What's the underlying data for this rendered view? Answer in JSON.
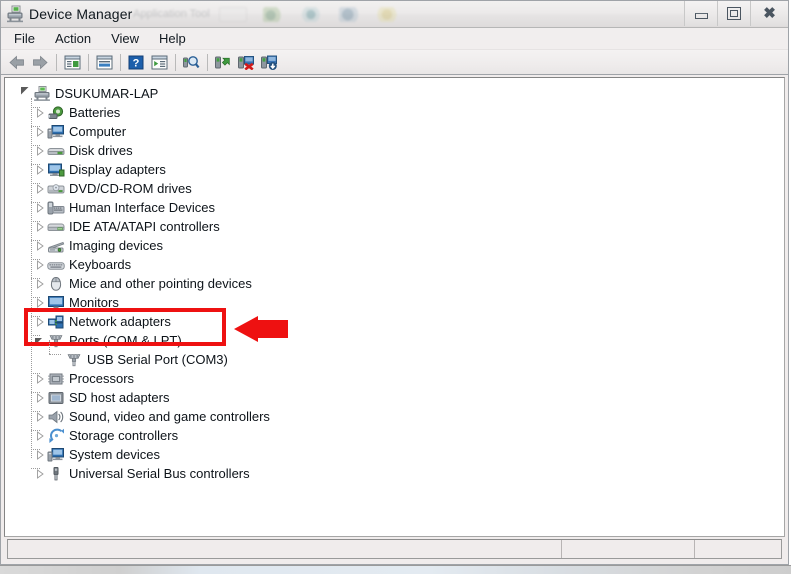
{
  "window": {
    "title": "Device Manager",
    "title_icon": "device-manager-icon",
    "ghost_text": "Application Tool",
    "controls": {
      "minimize": "Minimize",
      "maximize": "Maximize",
      "close": "Close"
    }
  },
  "menubar": {
    "items": [
      {
        "label": "File"
      },
      {
        "label": "Action"
      },
      {
        "label": "View"
      },
      {
        "label": "Help"
      }
    ]
  },
  "toolbar": {
    "buttons": [
      {
        "name": "back-button",
        "icon": "arrow-left-icon",
        "label": "Back"
      },
      {
        "name": "forward-button",
        "icon": "arrow-right-icon",
        "label": "Forward"
      },
      {
        "name": "show-hide-console-tree-button",
        "icon": "console-tree-icon",
        "label": "Show/Hide Console Tree"
      },
      {
        "name": "properties-button",
        "icon": "properties-icon",
        "label": "Properties"
      },
      {
        "name": "help-button",
        "icon": "help-question-icon",
        "label": "Help"
      },
      {
        "name": "show-hide-action-pane-button",
        "icon": "action-pane-icon",
        "label": "Show/Hide Action Pane"
      },
      {
        "name": "scan-for-hardware-changes-button",
        "icon": "scan-hardware-icon",
        "label": "Scan for hardware changes"
      },
      {
        "name": "update-driver-button",
        "icon": "update-driver-icon",
        "label": "Update Driver Software"
      },
      {
        "name": "disable-device-button",
        "icon": "disable-device-icon",
        "label": "Disable"
      },
      {
        "name": "uninstall-device-button",
        "icon": "uninstall-device-icon",
        "label": "Uninstall"
      }
    ]
  },
  "tree": {
    "root": {
      "label": "DSUKUMAR-LAP",
      "icon": "computer-root-icon",
      "expanded": true
    },
    "items": [
      {
        "label": "Batteries",
        "icon": "battery-icon",
        "expanded": false,
        "level": 1
      },
      {
        "label": "Computer",
        "icon": "computer-icon",
        "expanded": false,
        "level": 1
      },
      {
        "label": "Disk drives",
        "icon": "disk-drive-icon",
        "expanded": false,
        "level": 1
      },
      {
        "label": "Display adapters",
        "icon": "display-adapter-icon",
        "expanded": false,
        "level": 1
      },
      {
        "label": "DVD/CD-ROM drives",
        "icon": "dvd-drive-icon",
        "expanded": false,
        "level": 1
      },
      {
        "label": "Human Interface Devices",
        "icon": "hid-icon",
        "expanded": false,
        "level": 1
      },
      {
        "label": "IDE ATA/ATAPI controllers",
        "icon": "ide-controller-icon",
        "expanded": false,
        "level": 1
      },
      {
        "label": "Imaging devices",
        "icon": "imaging-device-icon",
        "expanded": false,
        "level": 1
      },
      {
        "label": "Keyboards",
        "icon": "keyboard-icon",
        "expanded": false,
        "level": 1
      },
      {
        "label": "Mice and other pointing devices",
        "icon": "mouse-icon",
        "expanded": false,
        "level": 1
      },
      {
        "label": "Monitors",
        "icon": "monitor-icon",
        "expanded": false,
        "level": 1
      },
      {
        "label": "Network adapters",
        "icon": "network-adapter-icon",
        "expanded": false,
        "level": 1
      },
      {
        "label": "Ports (COM & LPT)",
        "icon": "port-icon",
        "expanded": true,
        "level": 1,
        "highlighted": true
      },
      {
        "label": "USB Serial Port (COM3)",
        "icon": "port-icon",
        "expanded": null,
        "level": 2,
        "highlighted": true
      },
      {
        "label": "Processors",
        "icon": "processor-icon",
        "expanded": false,
        "level": 1
      },
      {
        "label": "SD host adapters",
        "icon": "sd-host-adapter-icon",
        "expanded": false,
        "level": 1
      },
      {
        "label": "Sound, video and game controllers",
        "icon": "sound-device-icon",
        "expanded": false,
        "level": 1
      },
      {
        "label": "Storage controllers",
        "icon": "storage-controller-icon",
        "expanded": false,
        "level": 1
      },
      {
        "label": "System devices",
        "icon": "system-device-icon",
        "expanded": false,
        "level": 1
      },
      {
        "label": "Universal Serial Bus controllers",
        "icon": "usb-controller-icon",
        "expanded": false,
        "level": 1
      }
    ]
  },
  "annotations": {
    "highlight_color": "#ee1111",
    "box": {
      "name": "red-highlight-box",
      "target": "Ports (COM & LPT) / USB Serial Port (COM3)"
    },
    "arrow": {
      "name": "red-pointer-arrow",
      "direction": "left",
      "target": "USB Serial Port (COM3)"
    }
  },
  "statusbar": {
    "panes": [
      {
        "name": "status-pane-main",
        "text": ""
      },
      {
        "name": "status-pane-secondary",
        "text": ""
      },
      {
        "name": "status-pane-tertiary",
        "text": ""
      }
    ]
  }
}
